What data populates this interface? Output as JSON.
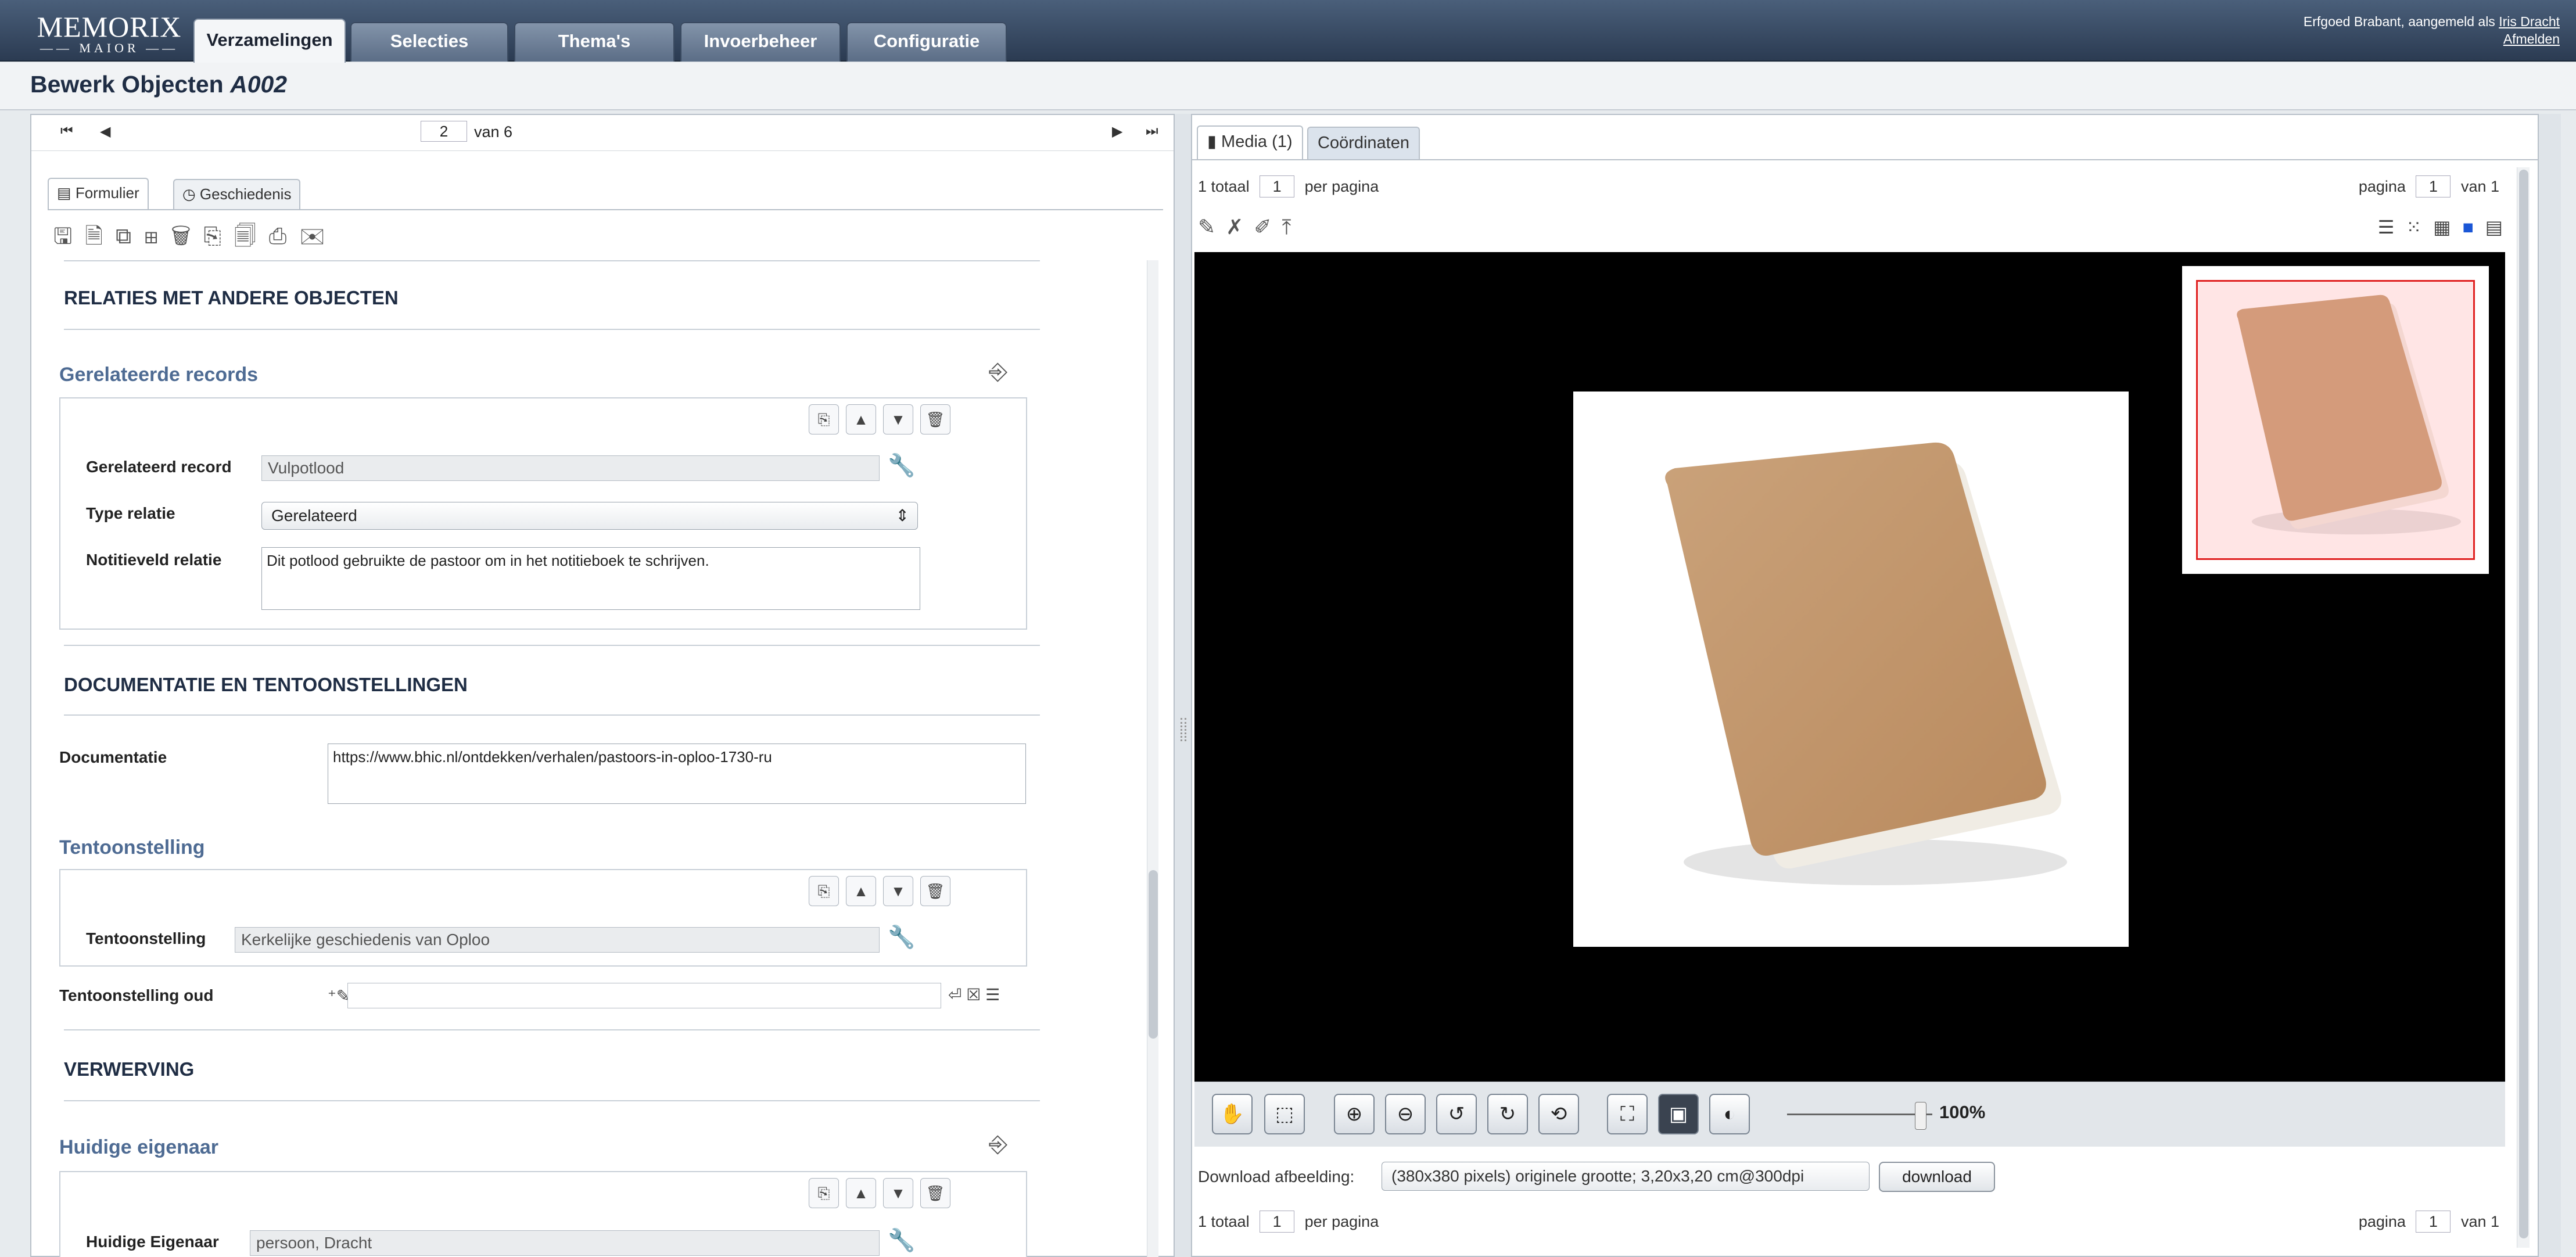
{
  "app": {
    "logo_line1": "MEMORIX",
    "logo_line2": "MAIOR",
    "tabs": [
      "Verzamelingen",
      "Selecties",
      "Thema's",
      "Invoerbeheer",
      "Configuratie"
    ],
    "active_tab": "Verzamelingen",
    "user_text": "Erfgoed Brabant, aangemeld als",
    "user_name": "Iris Dracht",
    "logout": "Afmelden"
  },
  "page": {
    "title_prefix": "Bewerk Objecten",
    "title_id": "A002"
  },
  "form": {
    "pager": {
      "current": "2",
      "of_label": "van 6"
    },
    "subtabs": [
      "Formulier",
      "Geschiedenis"
    ],
    "sections": {
      "relaties": "RELATIES MET ANDERE OBJECTEN",
      "documentatie": "DOCUMENTATIE EN TENTOONSTELLINGEN",
      "verwerving": "VERWERVING"
    },
    "gerelateerde": {
      "title": "Gerelateerde records",
      "record_label": "Gerelateerd record",
      "record_value": "Vulpotlood",
      "type_label": "Type relatie",
      "type_value": "Gerelateerd",
      "note_label": "Notitieveld relatie",
      "note_value": "Dit potlood gebruikte de pastoor om in het notitieboek te schrijven."
    },
    "documentatie": {
      "label": "Documentatie",
      "value": "https://www.bhic.nl/ontdekken/verhalen/pastoors-in-oploo-1730-ru"
    },
    "tentoonstelling": {
      "title": "Tentoonstelling",
      "label": "Tentoonstelling",
      "value": "Kerkelijke geschiedenis van Oploo",
      "old_label": "Tentoonstelling oud",
      "old_value": ""
    },
    "eigenaar": {
      "title": "Huidige eigenaar",
      "label": "Huidige Eigenaar",
      "value": "persoon, Dracht"
    }
  },
  "media": {
    "tabs": [
      "Media (1)",
      "Coördinaten"
    ],
    "top_row": {
      "total": "1 totaal",
      "per_page_value": "1",
      "per_page_label": "per pagina",
      "page_label": "pagina",
      "page_value": "1",
      "of_label": "van 1"
    },
    "bottom_row": {
      "total": "1 totaal",
      "per_page_value": "1",
      "per_page_label": "per pagina",
      "page_label": "pagina",
      "page_value": "1",
      "of_label": "van 1"
    },
    "zoom": {
      "percent": "100%",
      "level": 1.0
    },
    "download_label": "Download afbeelding:",
    "download_option": "(380x380 pixels) originele grootte; 3,20x3,20 cm@300dpi",
    "download_button": "download"
  },
  "colors": {
    "topbar": "#2b3b52",
    "group_title": "#4e6b93",
    "thumb_frame": "#e02020"
  }
}
